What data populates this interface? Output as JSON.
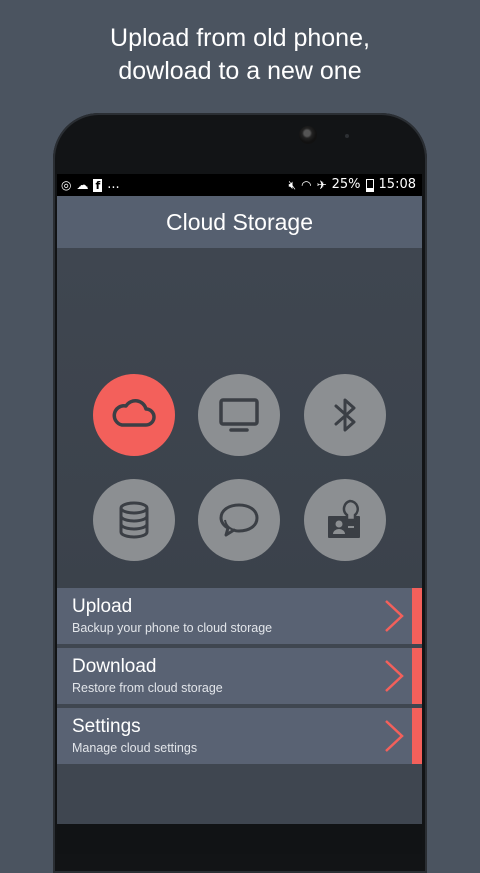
{
  "promo": {
    "line1": "Upload from old phone,",
    "line2": "dowload to a new one"
  },
  "status_bar": {
    "left_icons": [
      "camera-app-icon",
      "cloud-icon",
      "facebook-icon"
    ],
    "more": "...",
    "right_icons": [
      "mute-icon",
      "wifi-icon",
      "airplane-icon"
    ],
    "battery": "25%",
    "time": "15:08"
  },
  "app": {
    "title": "Cloud Storage"
  },
  "icon_grid": [
    {
      "name": "cloud-icon",
      "active": true
    },
    {
      "name": "monitor-icon",
      "active": false
    },
    {
      "name": "bluetooth-icon",
      "active": false
    },
    {
      "name": "database-icon",
      "active": false
    },
    {
      "name": "chat-icon",
      "active": false
    },
    {
      "name": "contact-lightbulb-icon",
      "active": false
    }
  ],
  "menu": [
    {
      "title": "Upload",
      "subtitle": "Backup your phone to cloud storage"
    },
    {
      "title": "Download",
      "subtitle": "Restore from cloud storage"
    },
    {
      "title": "Settings",
      "subtitle": "Manage cloud settings"
    }
  ],
  "colors": {
    "background": "#4b5460",
    "accent": "#f3605b",
    "icon_circle": "#8c8f92",
    "app_bar": "#566070",
    "menu_item": "#596273"
  }
}
